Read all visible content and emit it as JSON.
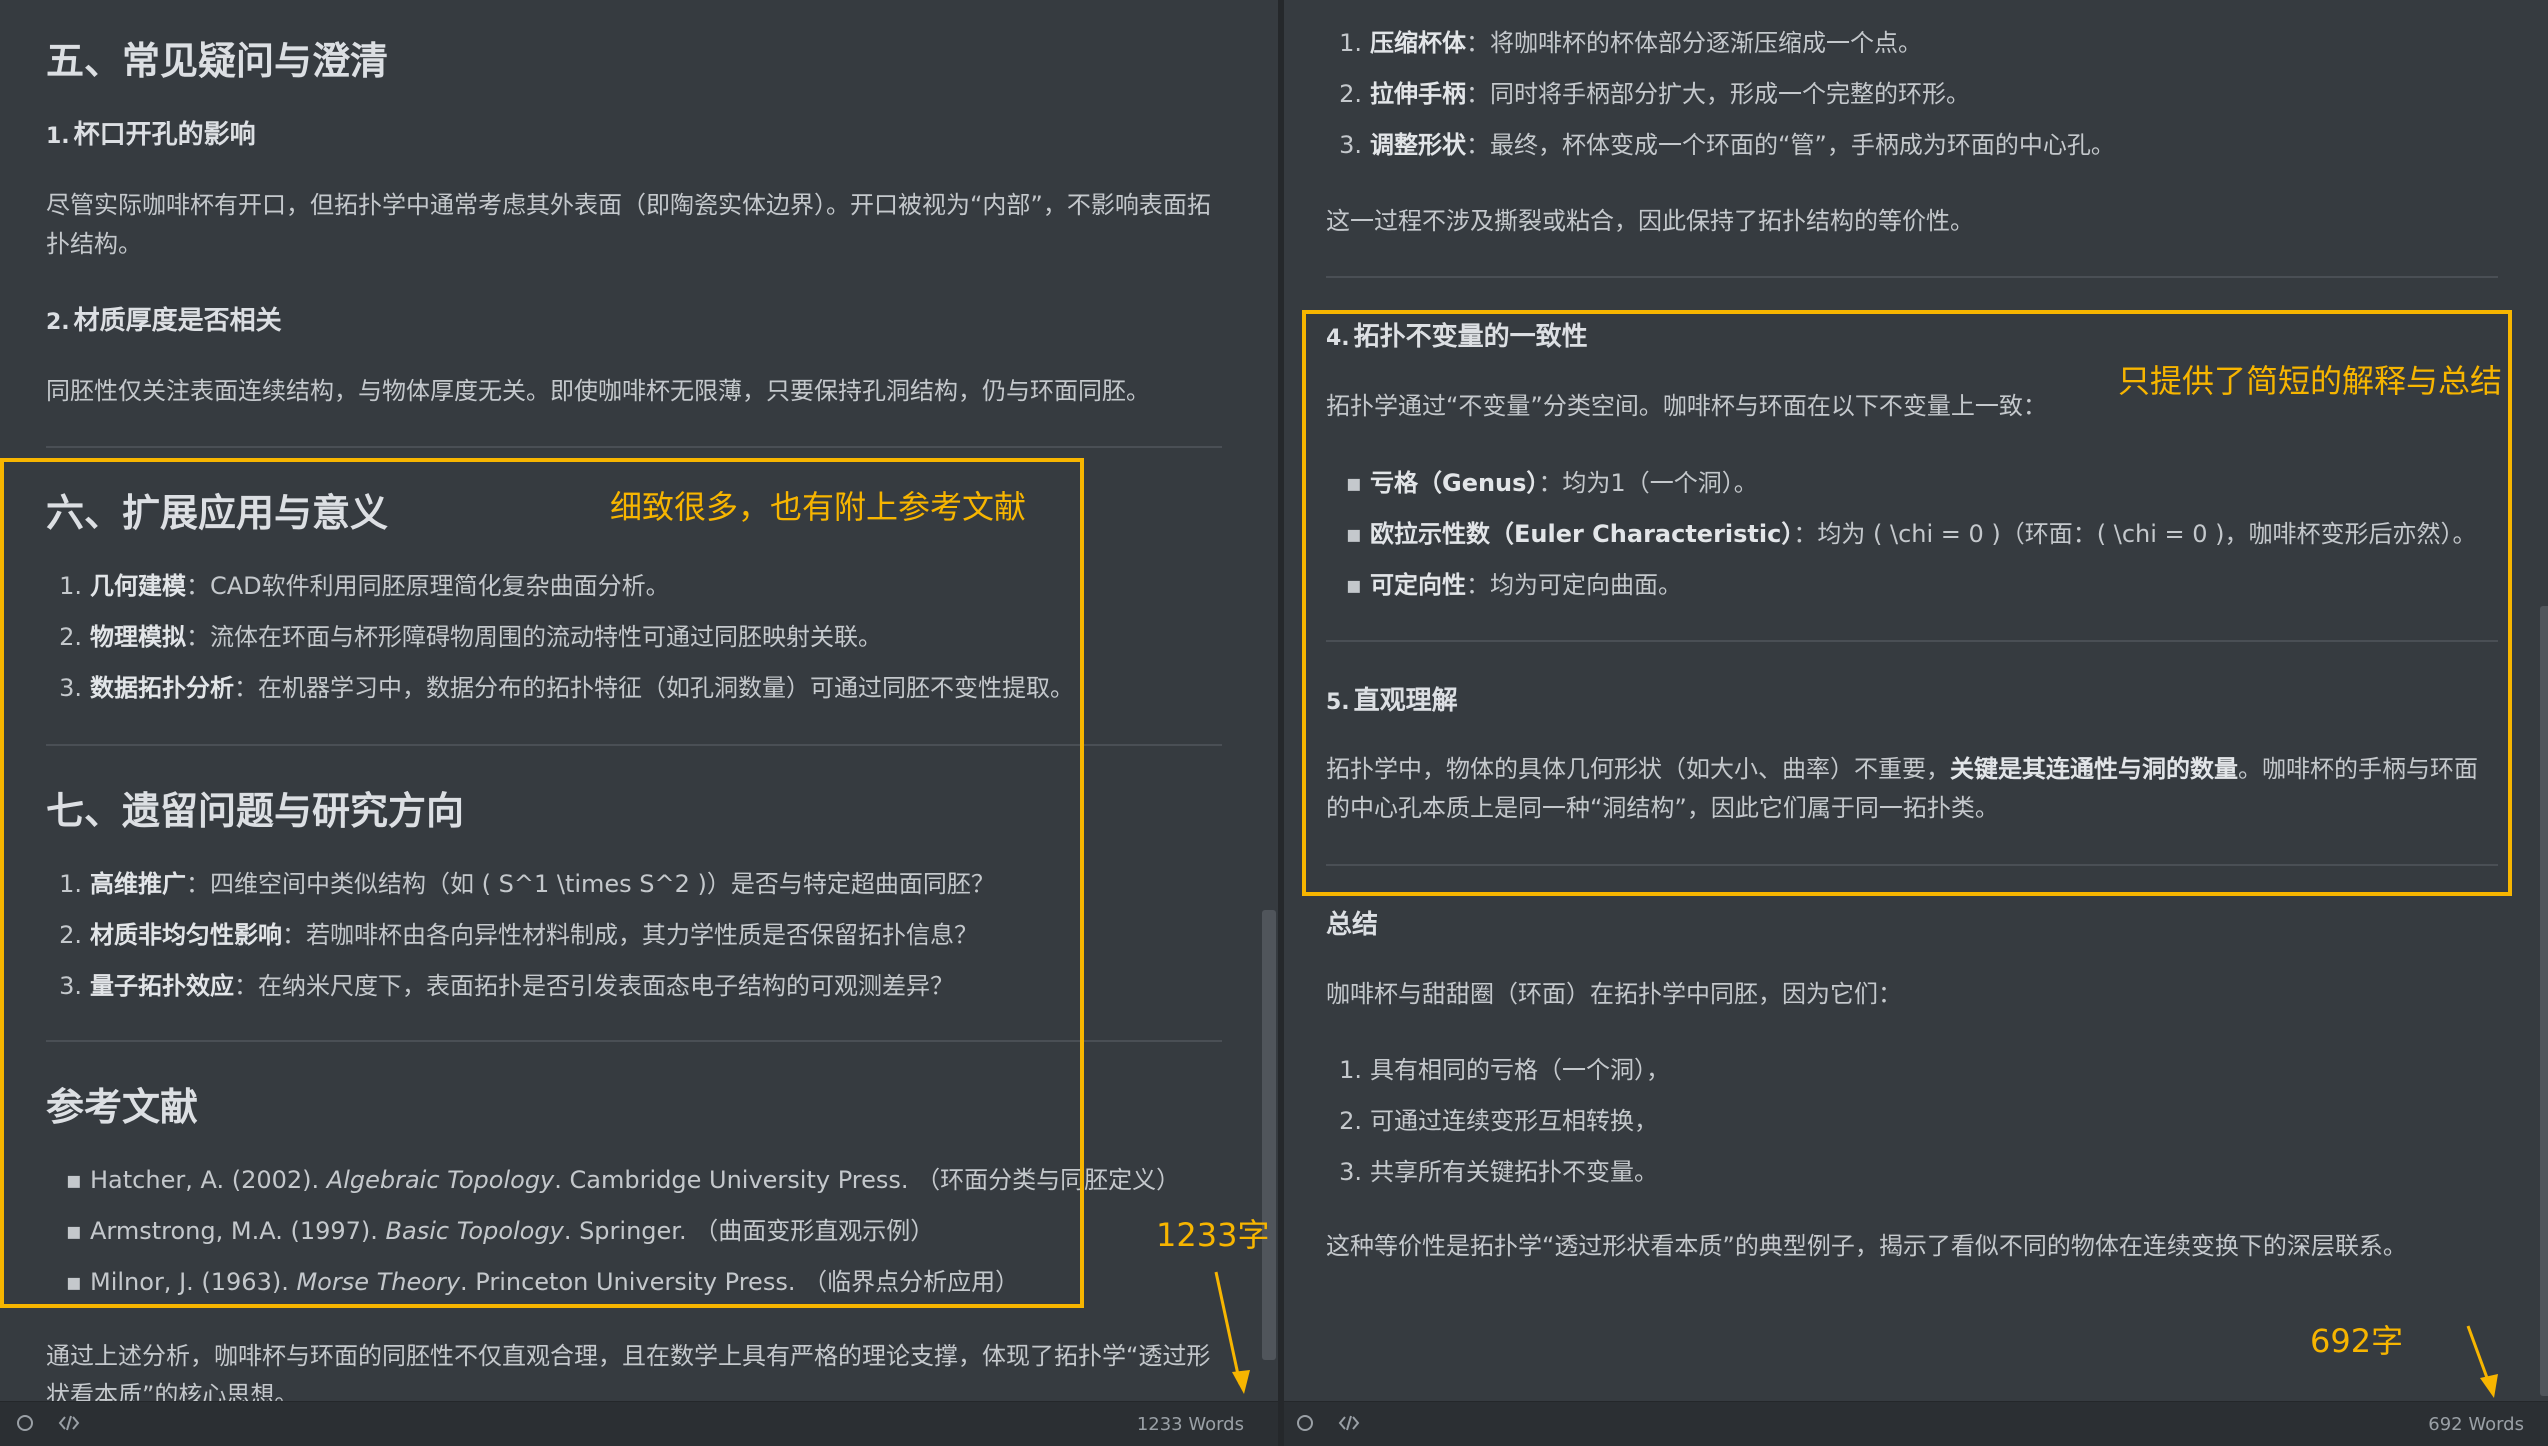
{
  "left": {
    "sec5": {
      "title": "五、常见疑问与澄清",
      "q1_num": "1.",
      "q1_title": "杯口开孔的影响",
      "q1_text": "尽管实际咖啡杯有开口，但拓扑学中通常考虑其外表面（即陶瓷实体边界）。开口被视为“内部”，不影响表面拓扑结构。",
      "q2_num": "2.",
      "q2_title": "材质厚度是否相关",
      "q2_text": "同胚性仅关注表面连续结构，与物体厚度无关。即使咖啡杯无限薄，只要保持孔洞结构，仍与环面同胚。"
    },
    "sec6": {
      "title": "六、扩展应用与意义",
      "items": [
        {
          "n": "1.",
          "b": "几何建模",
          "t": "：CAD软件利用同胚原理简化复杂曲面分析。"
        },
        {
          "n": "2.",
          "b": "物理模拟",
          "t": "：流体在环面与杯形障碍物周围的流动特性可通过同胚映射关联。"
        },
        {
          "n": "3.",
          "b": "数据拓扑分析",
          "t": "：在机器学习中，数据分布的拓扑特征（如孔洞数量）可通过同胚不变性提取。"
        }
      ]
    },
    "sec7": {
      "title": "七、遗留问题与研究方向",
      "items": [
        {
          "n": "1.",
          "b": "高维推广",
          "t": "：四维空间中类似结构（如 ( S^1 \\times S^2 )）是否与特定超曲面同胚？"
        },
        {
          "n": "2.",
          "b": "材质非均匀性影响",
          "t": "：若咖啡杯由各向异性材料制成，其力学性质是否保留拓扑信息？"
        },
        {
          "n": "3.",
          "b": "量子拓扑效应",
          "t": "：在纳米尺度下，表面拓扑是否引发表面态电子结构的可观测差异？"
        }
      ]
    },
    "refs": {
      "title": "参考文献",
      "items": [
        {
          "a": "Hatcher, A. (2002). ",
          "i": "Algebraic Topology",
          "c": ". Cambridge University Press. （环面分类与同胚定义）"
        },
        {
          "a": "Armstrong, M.A. (1997). ",
          "i": "Basic Topology",
          "c": ". Springer. （曲面变形直观示例）"
        },
        {
          "a": "Milnor, J. (1963). ",
          "i": "Morse Theory",
          "c": ". Princeton University Press. （临界点分析应用）"
        }
      ]
    },
    "conclusion": "通过上述分析，咖啡杯与环面的同胚性不仅直观合理，且在数学上具有严格的理论支撑，体现了拓扑学“透过形状看本质”的核心思想。",
    "annotation": "细致很多，也有附上参考文献",
    "count_annotation": "1233字",
    "status_words": "1233 Words"
  },
  "right": {
    "steps": [
      {
        "n": "1.",
        "b": "压缩杯体",
        "t": "：将咖啡杯的杯体部分逐渐压缩成一个点。"
      },
      {
        "n": "2.",
        "b": "拉伸手柄",
        "t": "：同时将手柄部分扩大，形成一个完整的环形。"
      },
      {
        "n": "3.",
        "b": "调整形状",
        "t": "：最终，杯体变成一个环面的“管”，手柄成为环面的中心孔。"
      }
    ],
    "steps_note": "这一过程不涉及撕裂或粘合，因此保持了拓扑结构的等价性。",
    "s4": {
      "num": "4.",
      "title": "拓扑不变量的一致性",
      "intro": "拓扑学通过“不变量”分类空间。咖啡杯与环面在以下不变量上一致：",
      "items": [
        {
          "b": "亏格（Genus）",
          "t": "：均为1（一个洞）。"
        },
        {
          "b": "欧拉示性数（Euler Characteristic）",
          "t": "：均为 ( \\chi = 0 )（环面：( \\chi = 0 )，咖啡杯变形后亦然）。"
        },
        {
          "b": "可定向性",
          "t": "：均为可定向曲面。"
        }
      ]
    },
    "s5": {
      "num": "5.",
      "title": "直观理解",
      "text_a": "拓扑学中，物体的具体几何形状（如大小、曲率）不重要，",
      "text_b": "关键是其连通性与洞的数量",
      "text_c": "。咖啡杯的手柄与环面的中心孔本质上是同一种“洞结构”，因此它们属于同一拓扑类。"
    },
    "summary": {
      "title": "总结",
      "intro": "咖啡杯与甜甜圈（环面）在拓扑学中同胚，因为它们：",
      "items": [
        {
          "n": "1.",
          "t": "具有相同的亏格（一个洞），"
        },
        {
          "n": "2.",
          "t": "可通过连续变形互相转换，"
        },
        {
          "n": "3.",
          "t": "共享所有关键拓扑不变量。"
        }
      ],
      "closing": "这种等价性是拓扑学“透过形状看本质”的典型例子，揭示了看似不同的物体在连续变换下的深层联系。"
    },
    "annotation": "只提供了简短的解释与总结",
    "count_annotation": "692字",
    "status_words": "692 Words"
  },
  "colors": {
    "annotation": "#f7b500",
    "background": "#363b40"
  },
  "icons": {
    "status_circle": "circle-icon",
    "source_code": "code-icon"
  }
}
